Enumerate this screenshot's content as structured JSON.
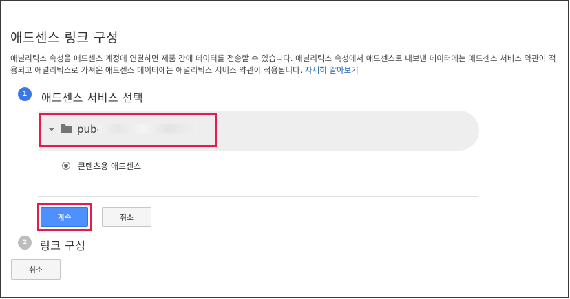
{
  "page": {
    "title": "애드센스 링크 구성",
    "description": "애널리틱스 속성을 애드센스 계정에 연결하면 제품 간에 데이터를 전송할 수 있습니다. 애널리틱스 속성에서 애드센스로 내보낸 데이터에는 애드센스 서비스 약관이 적용되고 애널리틱스로 가져온 애드센스 데이터에는 애널리틱스 서비스 약관이 적용됩니다.",
    "learn_more": "자세히 알아보기"
  },
  "step1": {
    "number": "1",
    "label": "애드센스 서비스 선택",
    "account_prefix": "pub-",
    "account_icon": "folder-icon",
    "radio_label": "콘텐츠용 애드센스",
    "continue_label": "계속",
    "cancel_label": "취소"
  },
  "step2": {
    "number": "2",
    "label": "링크 구성"
  },
  "footer": {
    "cancel_label": "취소"
  },
  "colors": {
    "accent": "#4d90fe",
    "highlight": "#e8194f",
    "step_active": "#3b78e7",
    "step_inactive": "#bdbdbd"
  }
}
